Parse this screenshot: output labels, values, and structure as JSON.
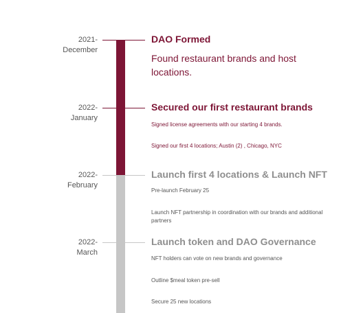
{
  "colors": {
    "completed": "#7d1535",
    "pending": "#c6c6c6",
    "pending_heading": "#8e8e8e",
    "body_text": "#555555"
  },
  "milestones": [
    {
      "date_line1": "2021-",
      "date_line2": "December",
      "title": "DAO Formed",
      "status": "completed",
      "items": [
        "Found restaurant brands and host locations."
      ]
    },
    {
      "date_line1": "2022-",
      "date_line2": "January",
      "title": "Secured our first restaurant brands",
      "status": "completed",
      "items": [
        "Signed license agreements with our starting 4 brands.",
        "Signed our first 4 locations;  Austin (2) , Chicago, NYC"
      ]
    },
    {
      "date_line1": "2022-",
      "date_line2": "February",
      "title": "Launch first 4 locations & Launch NFT",
      "status": "pending",
      "items": [
        "Pre-launch February 25",
        "Launch NFT partnership in coordination with our brands and additional partners"
      ]
    },
    {
      "date_line1": "2022-",
      "date_line2": "March",
      "title": "Launch token and DAO Governance",
      "status": "pending",
      "items": [
        "NFT holders can vote on new brands and governance",
        "Outline $meal token pre-sell",
        "Secure 25 new locations"
      ]
    }
  ]
}
